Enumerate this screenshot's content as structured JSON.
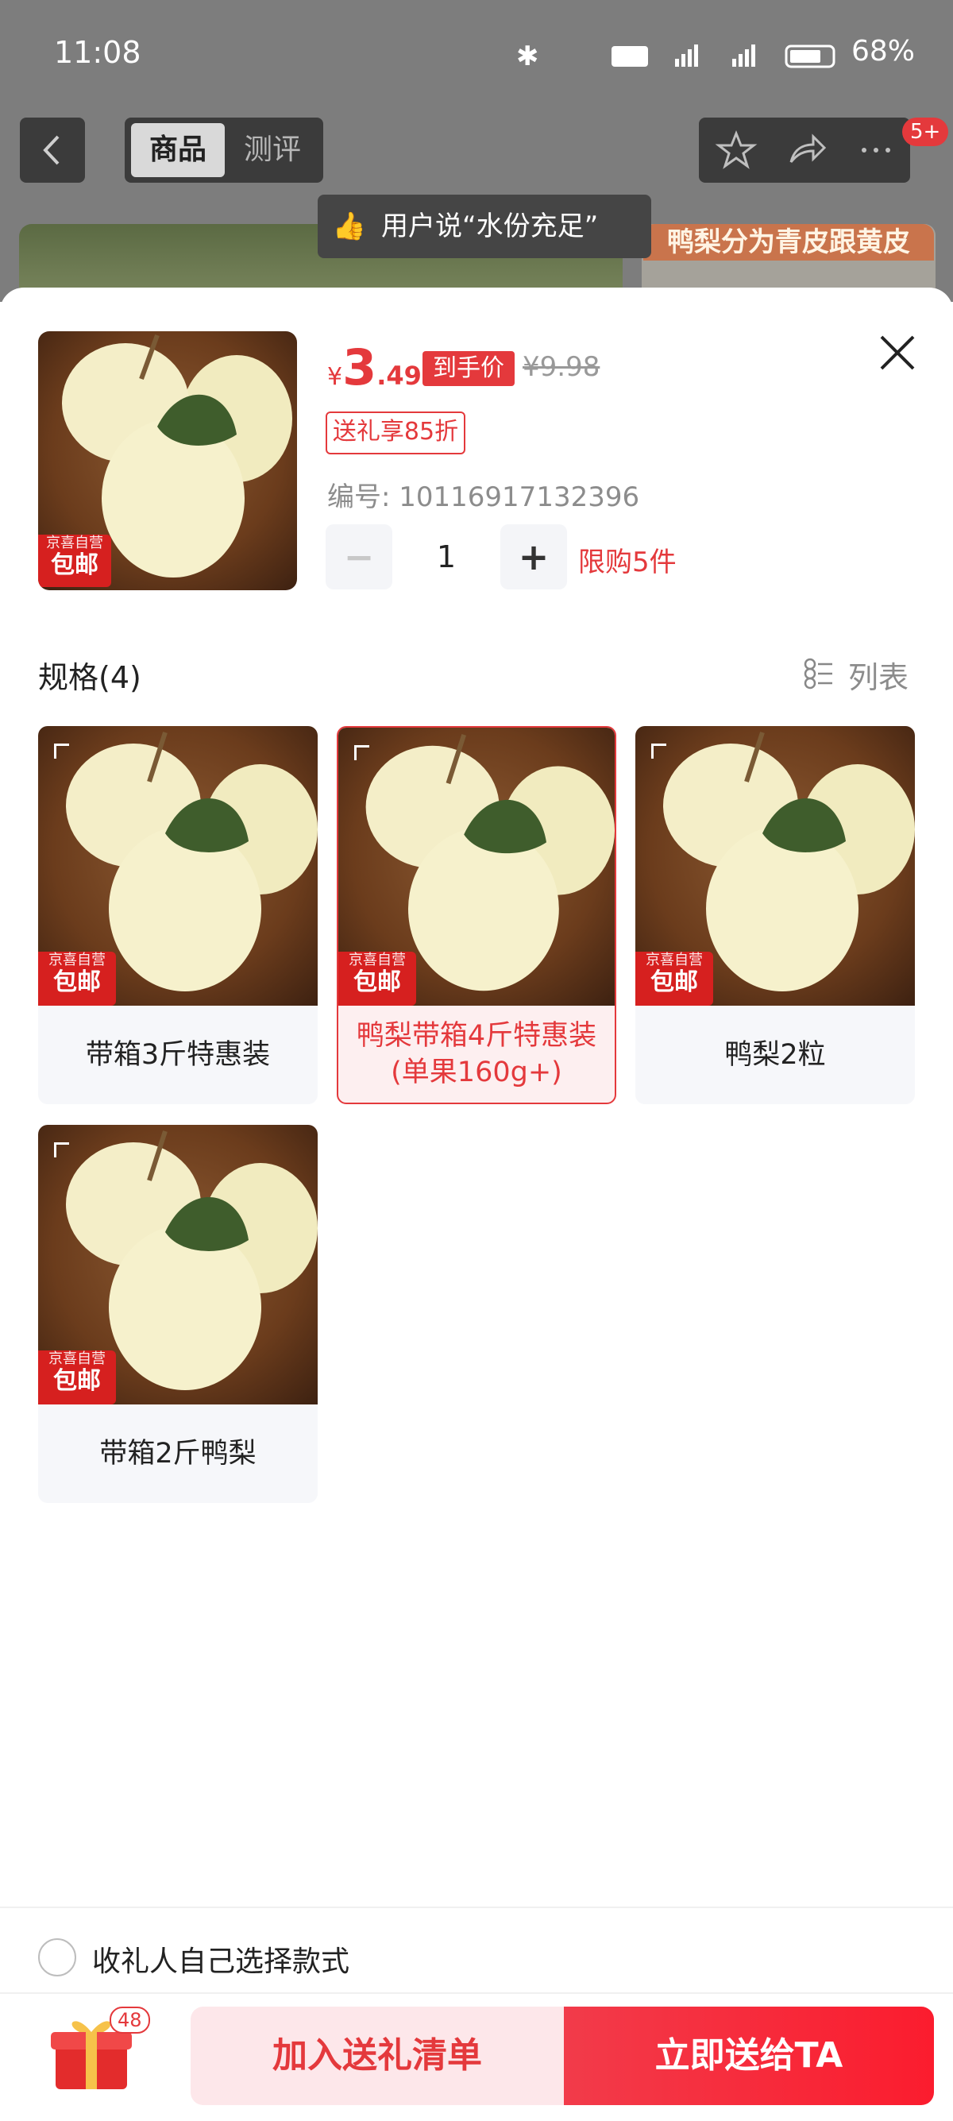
{
  "status_bar": {
    "time": "11:08",
    "battery": "68%"
  },
  "background_page": {
    "tabs": [
      "商品",
      "测评"
    ],
    "toast": "用户说“水份充足”",
    "banner": "鸭梨分为青皮跟黄皮",
    "badge": "5+"
  },
  "product": {
    "price_symbol": "¥",
    "price_int": "3",
    "price_dec": ".49",
    "price_tag": "到手价",
    "original_price": "¥9.98",
    "gift_discount": "送礼享85折",
    "sku_label": "编号: 10116917132396",
    "quantity": "1",
    "limit": "限购5件",
    "jd_line1": "京喜自营",
    "jd_line2": "包邮"
  },
  "specs": {
    "title": "规格(4)",
    "view_toggle": "列表",
    "items": [
      {
        "label": "带箱3斤特惠装",
        "selected": false
      },
      {
        "label": "鸭梨带箱4斤特惠装\n(单果160g+)",
        "selected": true
      },
      {
        "label": "鸭梨2粒",
        "selected": false
      },
      {
        "label": "带箱2斤鸭梨",
        "selected": false
      }
    ]
  },
  "recipient_option": "收礼人自己选择款式",
  "bottom_bar": {
    "gift_count": "48",
    "add_label": "加入送礼清单",
    "send_label": "立即送给TA"
  },
  "colors": {
    "accent": "#e4393c"
  }
}
